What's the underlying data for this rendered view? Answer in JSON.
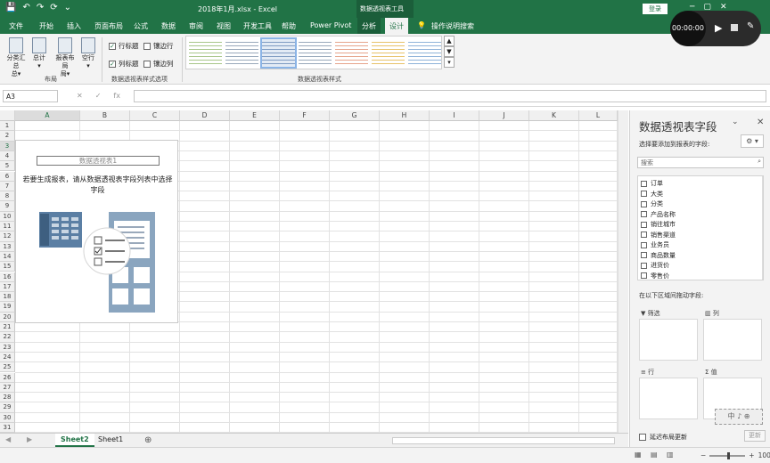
{
  "titlebar": {
    "filename": "2018年1月.xlsx - Excel",
    "context_title": "数据透视表工具",
    "login": "登录",
    "qat": [
      "💾",
      "↶",
      "↷",
      "⟳",
      "⌄"
    ],
    "window_controls": [
      "─",
      "▢",
      "✕"
    ]
  },
  "ribbon_tabs": [
    "文件",
    "开始",
    "插入",
    "页面布局",
    "公式",
    "数据",
    "审阅",
    "视图",
    "开发工具",
    "帮助",
    "Power Pivot",
    "分析",
    "设计"
  ],
  "tell_me": "操作说明搜索",
  "ribbon": {
    "buttons": [
      {
        "label": "分类汇总",
        "sub": "总▾"
      },
      {
        "label": "总计",
        "sub": "▾"
      },
      {
        "label": "报表布局",
        "sub": "局▾"
      },
      {
        "label": "空行",
        "sub": "▾"
      }
    ],
    "group_layout": "布局",
    "checks": [
      {
        "label": "行标题",
        "checked": true
      },
      {
        "label": "镶边行",
        "checked": false
      },
      {
        "label": "列标题",
        "checked": true
      },
      {
        "label": "镶边列",
        "checked": false
      }
    ],
    "group_options": "数据透视表样式选项",
    "group_styles": "数据透视表样式"
  },
  "recorder": {
    "time": "00:00:00"
  },
  "formula_bar": {
    "namebox": "A3",
    "fx": "fx",
    "value": ""
  },
  "sheet": {
    "columns": [
      "A",
      "B",
      "C",
      "D",
      "E",
      "F",
      "G",
      "H",
      "I",
      "J",
      "K",
      "L"
    ],
    "rows": [
      "1",
      "2",
      "3",
      "4",
      "5",
      "6",
      "7",
      "8",
      "9",
      "10",
      "11",
      "12",
      "13",
      "14",
      "15",
      "16",
      "17",
      "18",
      "19",
      "20",
      "21",
      "22",
      "23",
      "24",
      "25",
      "26",
      "27",
      "28",
      "29",
      "30",
      "31"
    ]
  },
  "pivot_placeholder": {
    "name": "数据透视表1",
    "message": "若要生成报表，请从数据透视表字段列表中选择字段"
  },
  "sheet_tabs": [
    "Sheet2",
    "Sheet1"
  ],
  "add_sheet": "⊕",
  "panel": {
    "title": "数据透视表字段",
    "subtitle": "选择要添加到报表的字段:",
    "search_placeholder": "搜索",
    "fields": [
      "订单",
      "大类",
      "分类",
      "产品名称",
      "销往城市",
      "销售渠道",
      "业务员",
      "商品数量",
      "进货价",
      "零售价"
    ],
    "drag_text": "在以下区域间拖动字段:",
    "areas": {
      "filter": "筛选",
      "columns": "列",
      "rows": "行",
      "values": "值"
    },
    "defer": "延迟布局更新",
    "update": "更新"
  },
  "watermark": "中 ♪ ⊕",
  "status": {
    "zoom": "100%"
  },
  "colors": {
    "accent": "#217346",
    "selection": "#217346"
  }
}
